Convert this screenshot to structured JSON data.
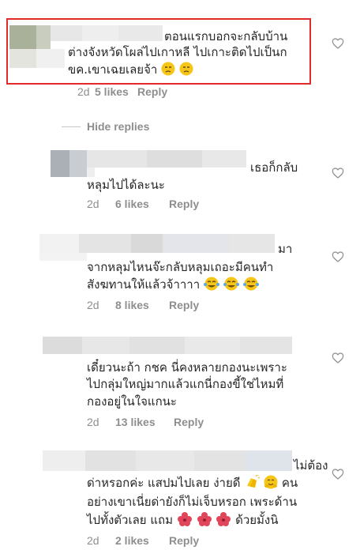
{
  "comments": [
    {
      "line_head": "ตอนแรกบอกจะกลับบ้าน",
      "line2": "ต่างจังหวัดโผล่ไปเกาหลี ไปเกาะติดไปเป็นก",
      "line3": "ขค.เขาเฉยเลยจ้า",
      "time": "2d",
      "likes": "5 likes",
      "reply": "Reply"
    },
    {
      "line_head": "เธอก็กลับ",
      "line2": "หลุมไปได้ละนะ",
      "time": "2d",
      "likes": "6 likes",
      "reply": "Reply"
    },
    {
      "line_head": "มา",
      "line2": "จากหลุมไหนจ๊ะกลับหลุมเถอะมีคนทำ",
      "line3": "สังฆทานให้แล้วจ้าาาา",
      "time": "2d",
      "likes": "8 likes",
      "reply": "Reply"
    },
    {
      "line1": "เดี๋ยวนะถ้า กชค นี่คงหลายกองนะเพราะ",
      "line2": "ไปกลุ่มใหญ่มากแล้วแกนี่กองขี้ใช่ไหมที่",
      "line3": "กองอยู่ในใจแกนะ",
      "time": "2d",
      "likes": "13 likes",
      "reply": "Reply"
    },
    {
      "line_head": "ไม่ต้อง",
      "line2a": "ด่าหรอกค่ะ แสปมไปเลย ง่ายดี",
      "line2b": "คน",
      "line3": "อย่างเขาเนี่ยด่ายังก็ไม่เจ็บหรอก เพระด้าน",
      "line4a": "ไปทั้งตัวเลย แถม",
      "line4b": "ด้วยมั้งนิ",
      "time": "2d",
      "likes": "2 likes",
      "reply": "Reply"
    }
  ],
  "hide_replies": "Hide replies",
  "colors": {
    "highlight": "#e02b2b",
    "meta_text": "#8e8e8e",
    "comment_text": "#262626"
  }
}
